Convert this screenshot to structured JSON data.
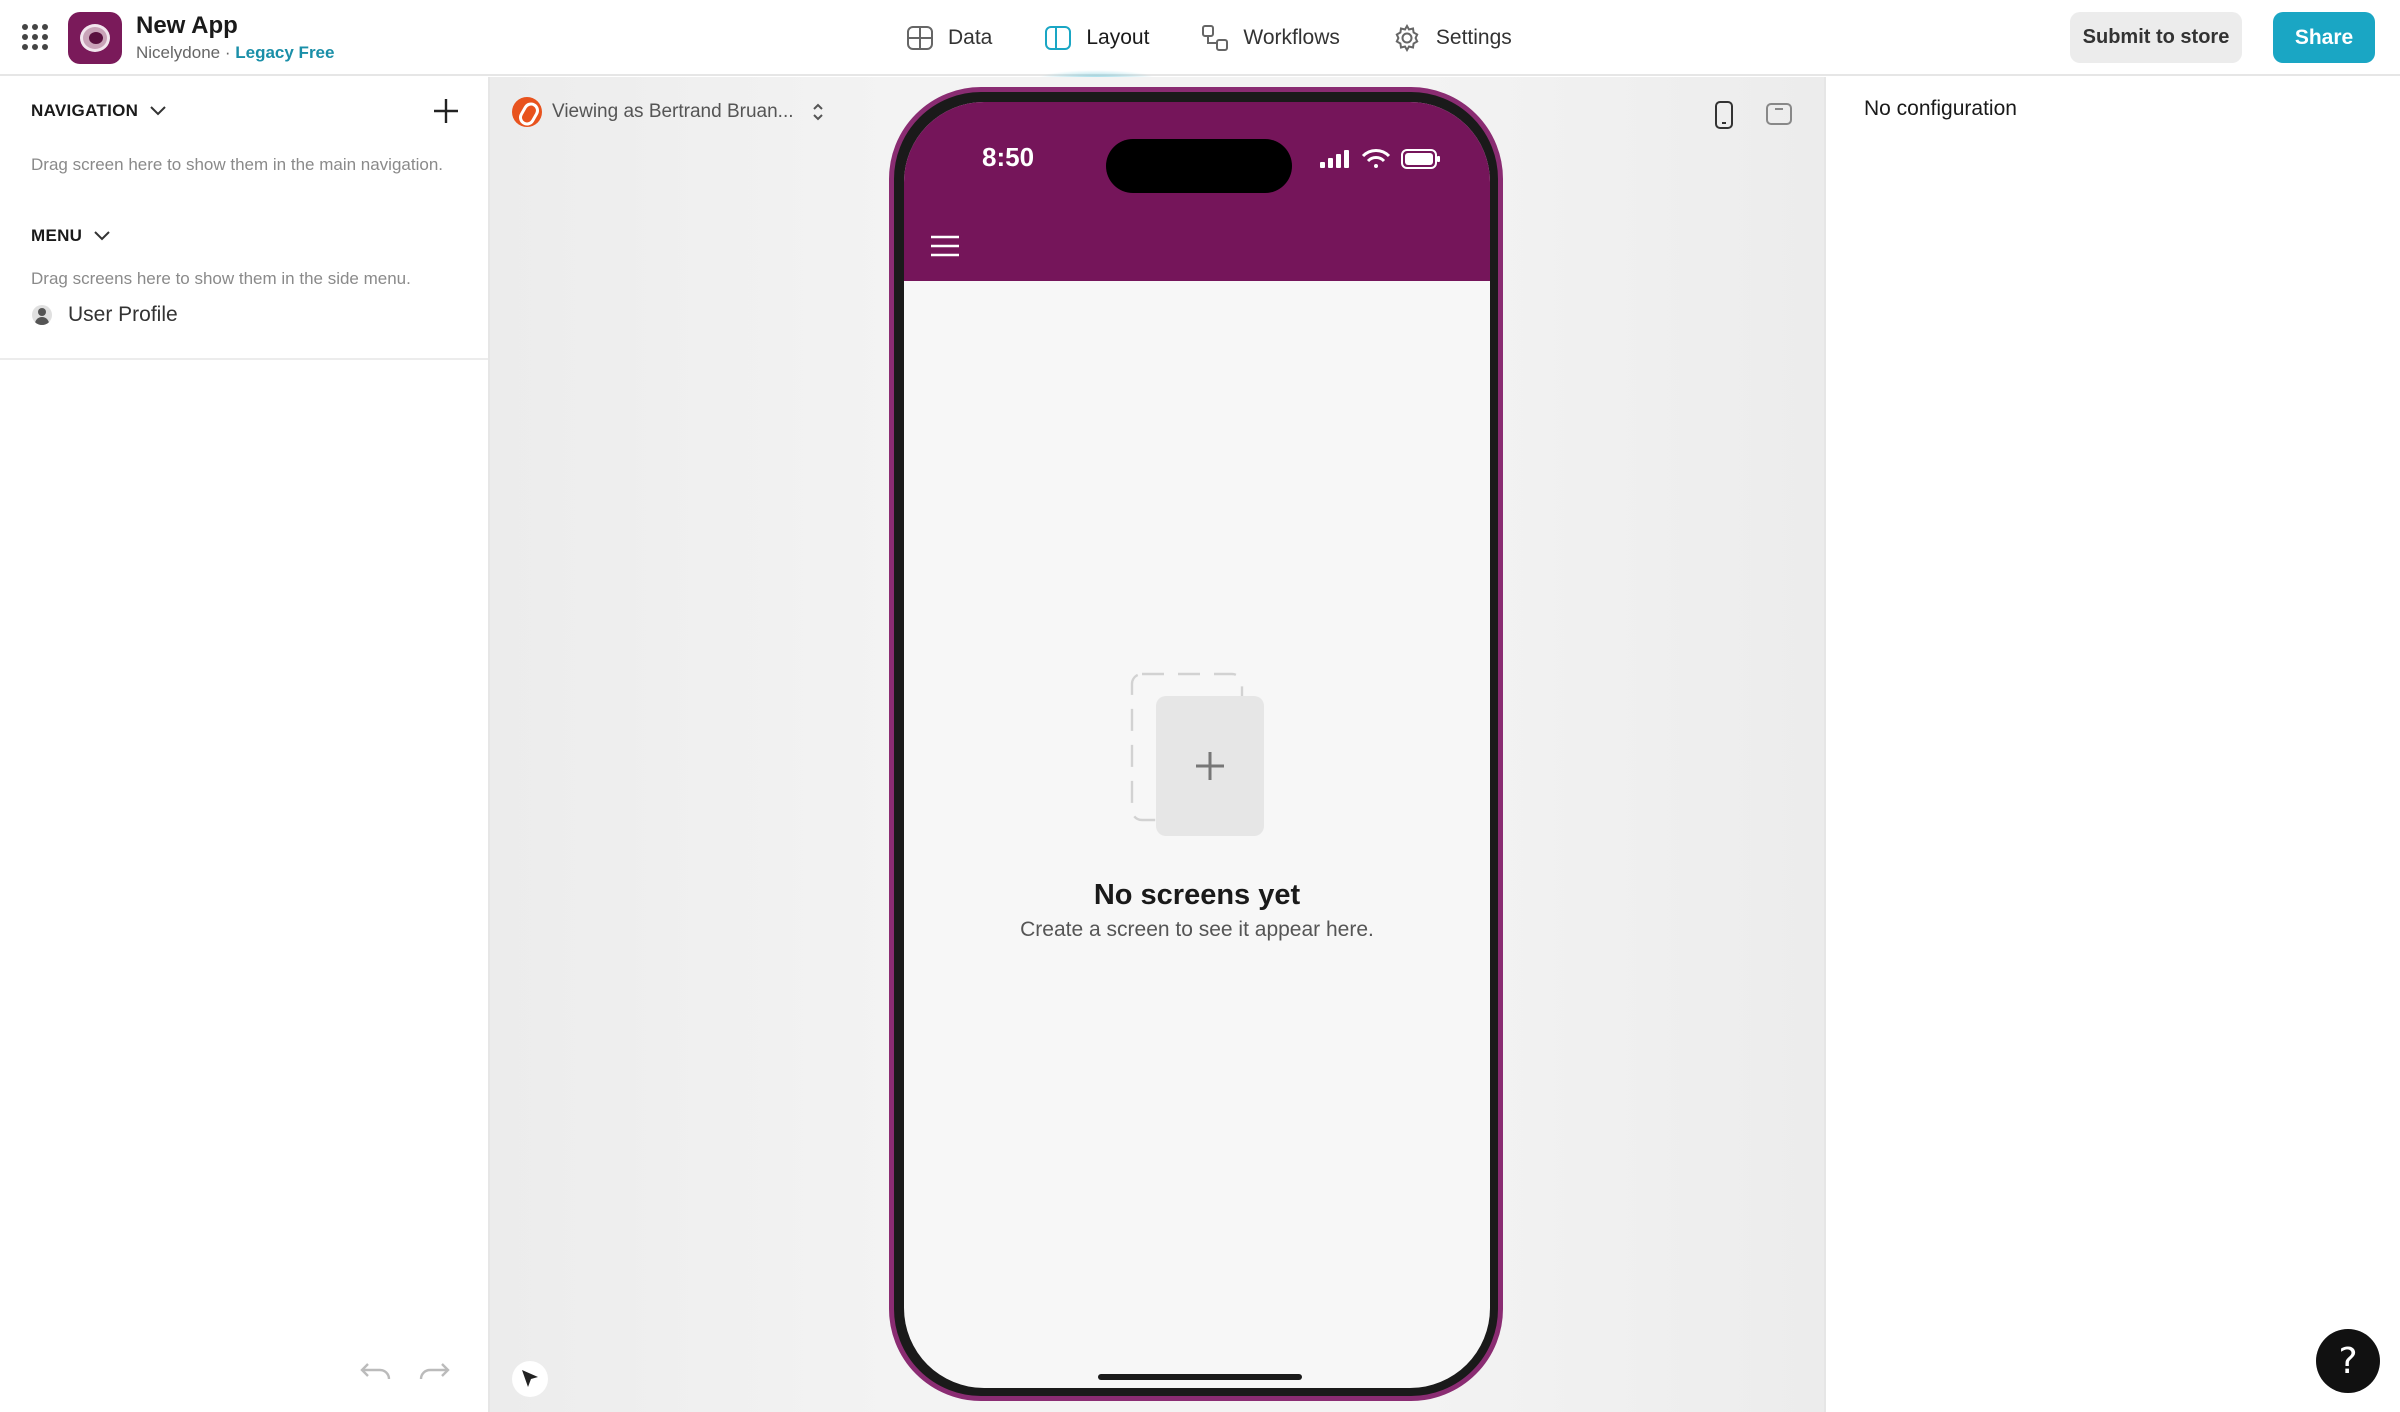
{
  "app": {
    "title": "New App",
    "org": "Nicelydone",
    "separator": "·",
    "plan": "Legacy Free"
  },
  "tabs": [
    {
      "label": "Data",
      "icon": "table-icon",
      "active": false
    },
    {
      "label": "Layout",
      "icon": "layout-icon",
      "active": true
    },
    {
      "label": "Workflows",
      "icon": "workflow-icon",
      "active": false
    },
    {
      "label": "Settings",
      "icon": "gear-icon",
      "active": false
    }
  ],
  "actions": {
    "submit_label": "Submit to store",
    "share_label": "Share"
  },
  "left": {
    "navigation_label": "NAVIGATION",
    "navigation_hint": "Drag screen here to show them in the main navigation.",
    "menu_label": "MENU",
    "menu_hint": "Drag screens here to show them in the side menu.",
    "menu_items": [
      {
        "label": "User Profile",
        "icon": "user-icon"
      }
    ]
  },
  "canvas": {
    "viewing_as": "Viewing as Bertrand Bruan..."
  },
  "phone": {
    "time": "8:50",
    "empty_title": "No screens yet",
    "empty_subtitle": "Create a screen to see it appear here."
  },
  "right": {
    "empty_label": "No configuration"
  },
  "help_label": "?",
  "colors": {
    "brand": "#75155a",
    "accent": "#1aa6c4",
    "plan": "#1a8fa8"
  }
}
